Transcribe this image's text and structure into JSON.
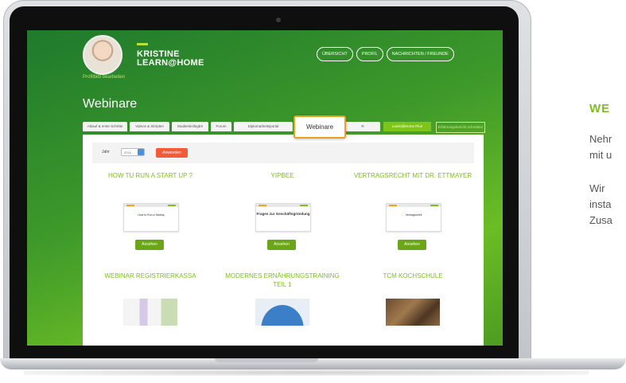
{
  "profile": {
    "name_line1": "KRISTINE",
    "name_line2": "LEARN@HOME",
    "edit_link": "Profilbild bearbeiten"
  },
  "topnav": [
    "ÜBERSICHT",
    "PROFIL",
    "NACHRICHTEN / FREUNDE"
  ],
  "page_title": "Webinare",
  "tabs": {
    "items": [
      "Ablauf & erste Schritte",
      "Videos & Skripten",
      "StudienkollegEn",
      "Forum",
      "Diplomarbeitsportal"
    ],
    "active": "Webinare",
    "after_active": "R",
    "plus": "Learn@Home Plus",
    "outline": "Erfahrungsbericht schreiben"
  },
  "filter": {
    "label": "Jahr",
    "select_value": "2016",
    "apply": "Anwenden"
  },
  "webinars": [
    {
      "title": "HOW TU RUN A START UP ?",
      "thumb": "How to Run a Startup",
      "button": "Ansehen"
    },
    {
      "title": "YIPBEE",
      "thumb": "Fragen zur Geschäftsgründung",
      "button": "Ansehen"
    },
    {
      "title": "VERTRAGSRECHT MIT DR. ETTMAYER",
      "thumb": "Vertragsrecht",
      "button": "Ansehen"
    },
    {
      "title": "WEBINAR REGISTRIERKASSA"
    },
    {
      "title": "MODERNES ERNÄHRUNGSTRAINING TEIL 1"
    },
    {
      "title": "TCM KOCHSCHULE"
    }
  ],
  "side": {
    "title": "WE",
    "line1": "Nehr",
    "line2": "mit u",
    "line3": "Wir",
    "line4": "insta",
    "line5": "Zusa"
  },
  "colors": {
    "accent": "#7dbf1e",
    "apply": "#f25a38",
    "highlight": "#f0a020"
  }
}
